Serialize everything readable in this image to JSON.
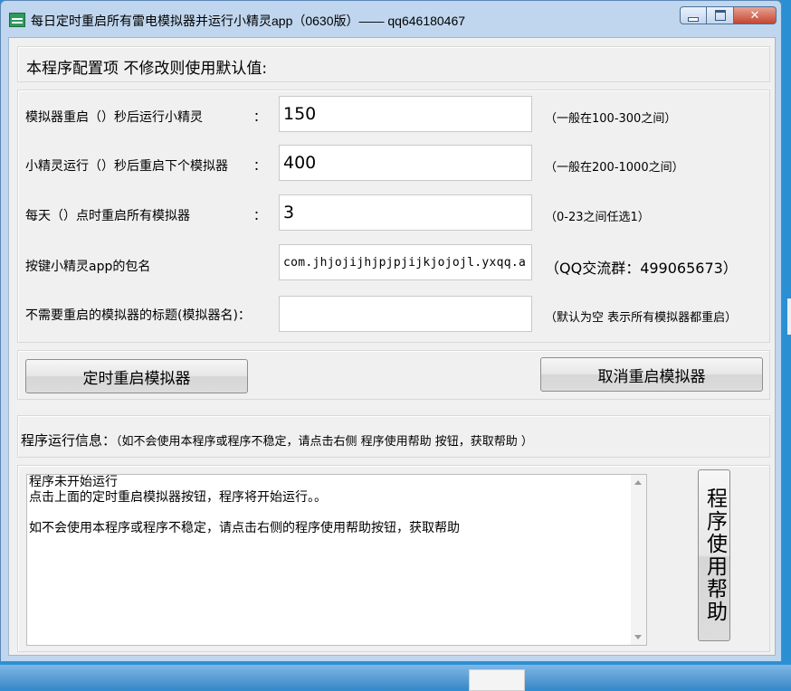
{
  "window": {
    "title": "每日定时重启所有雷电模拟器并运行小精灵app（0630版）—— qq646180467",
    "controls": {
      "minimize": "",
      "maximize": "",
      "close": "✕"
    }
  },
  "config_header": "本程序配置项 不修改则使用默认值:",
  "rows": [
    {
      "label": "模拟器重启（）秒后运行小精灵",
      "colon": "：",
      "value": "150",
      "hint": "（一般在100-300之间）"
    },
    {
      "label": "小精灵运行（）秒后重启下个模拟器",
      "colon": "：",
      "value": "400",
      "hint": "（一般在200-1000之间）"
    },
    {
      "label": "每天（）点时重启所有模拟器",
      "colon": "：",
      "value": "3",
      "hint": "（0-23之间任选1）"
    },
    {
      "label": "按键小精灵app的包名",
      "colon": "",
      "value": "com.jhjojijhjpjpjijkjojojl.yxqq.a",
      "hint": "（QQ交流群：499065673）"
    },
    {
      "label": "不需要重启的模拟器的标题(模拟器名)：",
      "colon": "",
      "value": "",
      "hint": "（默认为空 表示所有模拟器都重启）"
    }
  ],
  "buttons": {
    "start": "定时重启模拟器",
    "cancel": "取消重启模拟器",
    "help": "程序使用帮助"
  },
  "info": {
    "label": "程序运行信息：",
    "note": "（如不会使用本程序或程序不稳定，请点击右侧 程序使用帮助 按钮，获取帮助 ）",
    "log": "程序未开始运行\n点击上面的定时重启模拟器按钮，程序将开始运行。。\n\n如不会使用本程序或程序不稳定，请点击右侧的程序使用帮助按钮，获取帮助"
  }
}
